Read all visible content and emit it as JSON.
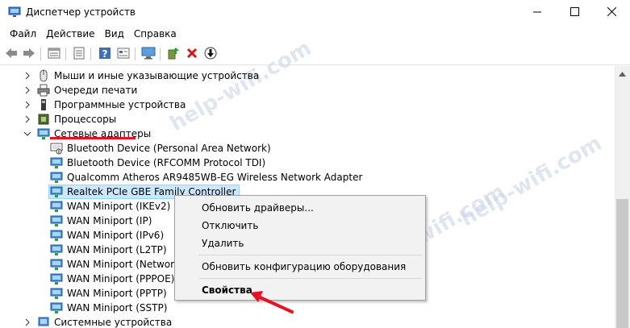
{
  "window": {
    "title": "Диспетчер устройств",
    "controls": [
      "minimize-icon",
      "maximize-icon",
      "close-icon"
    ]
  },
  "menu": {
    "items": [
      "Файл",
      "Действие",
      "Вид",
      "Справка"
    ]
  },
  "toolbar": {
    "buttons": [
      "back-arrow-icon",
      "forward-arrow-icon",
      "properties-sheet-icon",
      "list-view-icon",
      "help-icon",
      "properties-icon",
      "monitor-icon",
      "update-driver-icon",
      "uninstall-icon",
      "download-icon"
    ]
  },
  "tree": {
    "categories": [
      {
        "label": "Мыши и иные указывающие устройства",
        "expanded": false
      },
      {
        "label": "Очереди печати",
        "expanded": false
      },
      {
        "label": "Программные устройства",
        "expanded": false
      },
      {
        "label": "Процессоры",
        "expanded": false
      },
      {
        "label": "Сетевые адаптеры",
        "expanded": true
      },
      {
        "label": "Системные устройства",
        "expanded": false
      }
    ],
    "network_adapters": [
      "Bluetooth Device (Personal Area Network)",
      "Bluetooth Device (RFCOMM Protocol TDI)",
      "Qualcomm Atheros AR9485WB-EG Wireless Network Adapter",
      "Realtek PCIe GBE Family Controller",
      "WAN Miniport (IKEv2)",
      "WAN Miniport (IP)",
      "WAN Miniport (IPv6)",
      "WAN Miniport (L2TP)",
      "WAN Miniport (Network",
      "WAN Miniport (PPPOE)",
      "WAN Miniport (PPTP)",
      "WAN Miniport (SSTP)"
    ],
    "selected_item": "Realtek PCIe GBE Family Controller"
  },
  "context_menu": {
    "items": [
      {
        "label": "Обновить драйверы...",
        "bold": false
      },
      {
        "label": "Отключить",
        "bold": false
      },
      {
        "label": "Удалить",
        "bold": false
      },
      {
        "label": "Обновить конфигурацию оборудования",
        "bold": false
      },
      {
        "label": "Свойства",
        "bold": true
      }
    ]
  },
  "watermark": "help-wifi.com",
  "colors": {
    "selection_bg": "#cce8ff",
    "selection_border": "#99d1ff",
    "annotation_red": "#e81123",
    "menu_bg": "#f2f2f2"
  }
}
